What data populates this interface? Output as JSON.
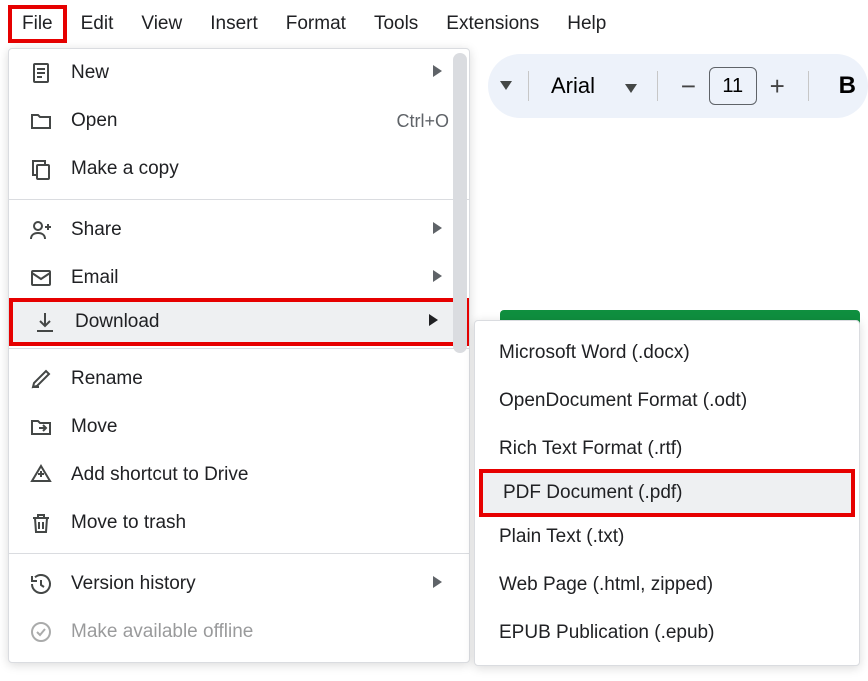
{
  "menubar": {
    "file": "File",
    "edit": "Edit",
    "view": "View",
    "insert": "Insert",
    "format": "Format",
    "tools": "Tools",
    "extensions": "Extensions",
    "help": "Help"
  },
  "toolbar": {
    "font_name": "Arial",
    "font_size": "11",
    "minus": "−",
    "plus": "+",
    "bold": "B"
  },
  "file_menu": {
    "new": "New",
    "open": "Open",
    "open_shortcut": "Ctrl+O",
    "make_copy": "Make a copy",
    "share": "Share",
    "email": "Email",
    "download": "Download",
    "rename": "Rename",
    "move": "Move",
    "add_shortcut": "Add shortcut to Drive",
    "move_trash": "Move to trash",
    "version_history": "Version history",
    "make_offline": "Make available offline"
  },
  "download_menu": {
    "docx": "Microsoft Word (.docx)",
    "odt": "OpenDocument Format (.odt)",
    "rtf": "Rich Text Format (.rtf)",
    "pdf": "PDF Document (.pdf)",
    "txt": "Plain Text (.txt)",
    "html": "Web Page (.html, zipped)",
    "epub": "EPUB Publication (.epub)"
  }
}
